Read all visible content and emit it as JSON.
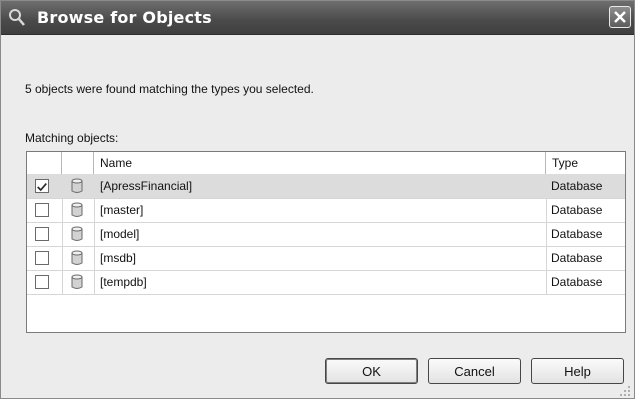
{
  "window": {
    "title": "Browse for Objects"
  },
  "icons": {
    "title": "search-icon",
    "close": "close-icon",
    "row": "database-icon",
    "grip": "resize-grip-icon"
  },
  "message": "5 objects were found matching the types you selected.",
  "matching_label": "Matching objects:",
  "columns": {
    "check": "",
    "icon": "",
    "name": "Name",
    "type": "Type"
  },
  "rows": [
    {
      "name": "[ApressFinancial]",
      "type": "Database",
      "checked": true,
      "selected": true
    },
    {
      "name": "[master]",
      "type": "Database",
      "checked": false,
      "selected": false
    },
    {
      "name": "[model]",
      "type": "Database",
      "checked": false,
      "selected": false
    },
    {
      "name": "[msdb]",
      "type": "Database",
      "checked": false,
      "selected": false
    },
    {
      "name": "[tempdb]",
      "type": "Database",
      "checked": false,
      "selected": false
    }
  ],
  "buttons": {
    "ok": "OK",
    "cancel": "Cancel",
    "help": "Help"
  }
}
